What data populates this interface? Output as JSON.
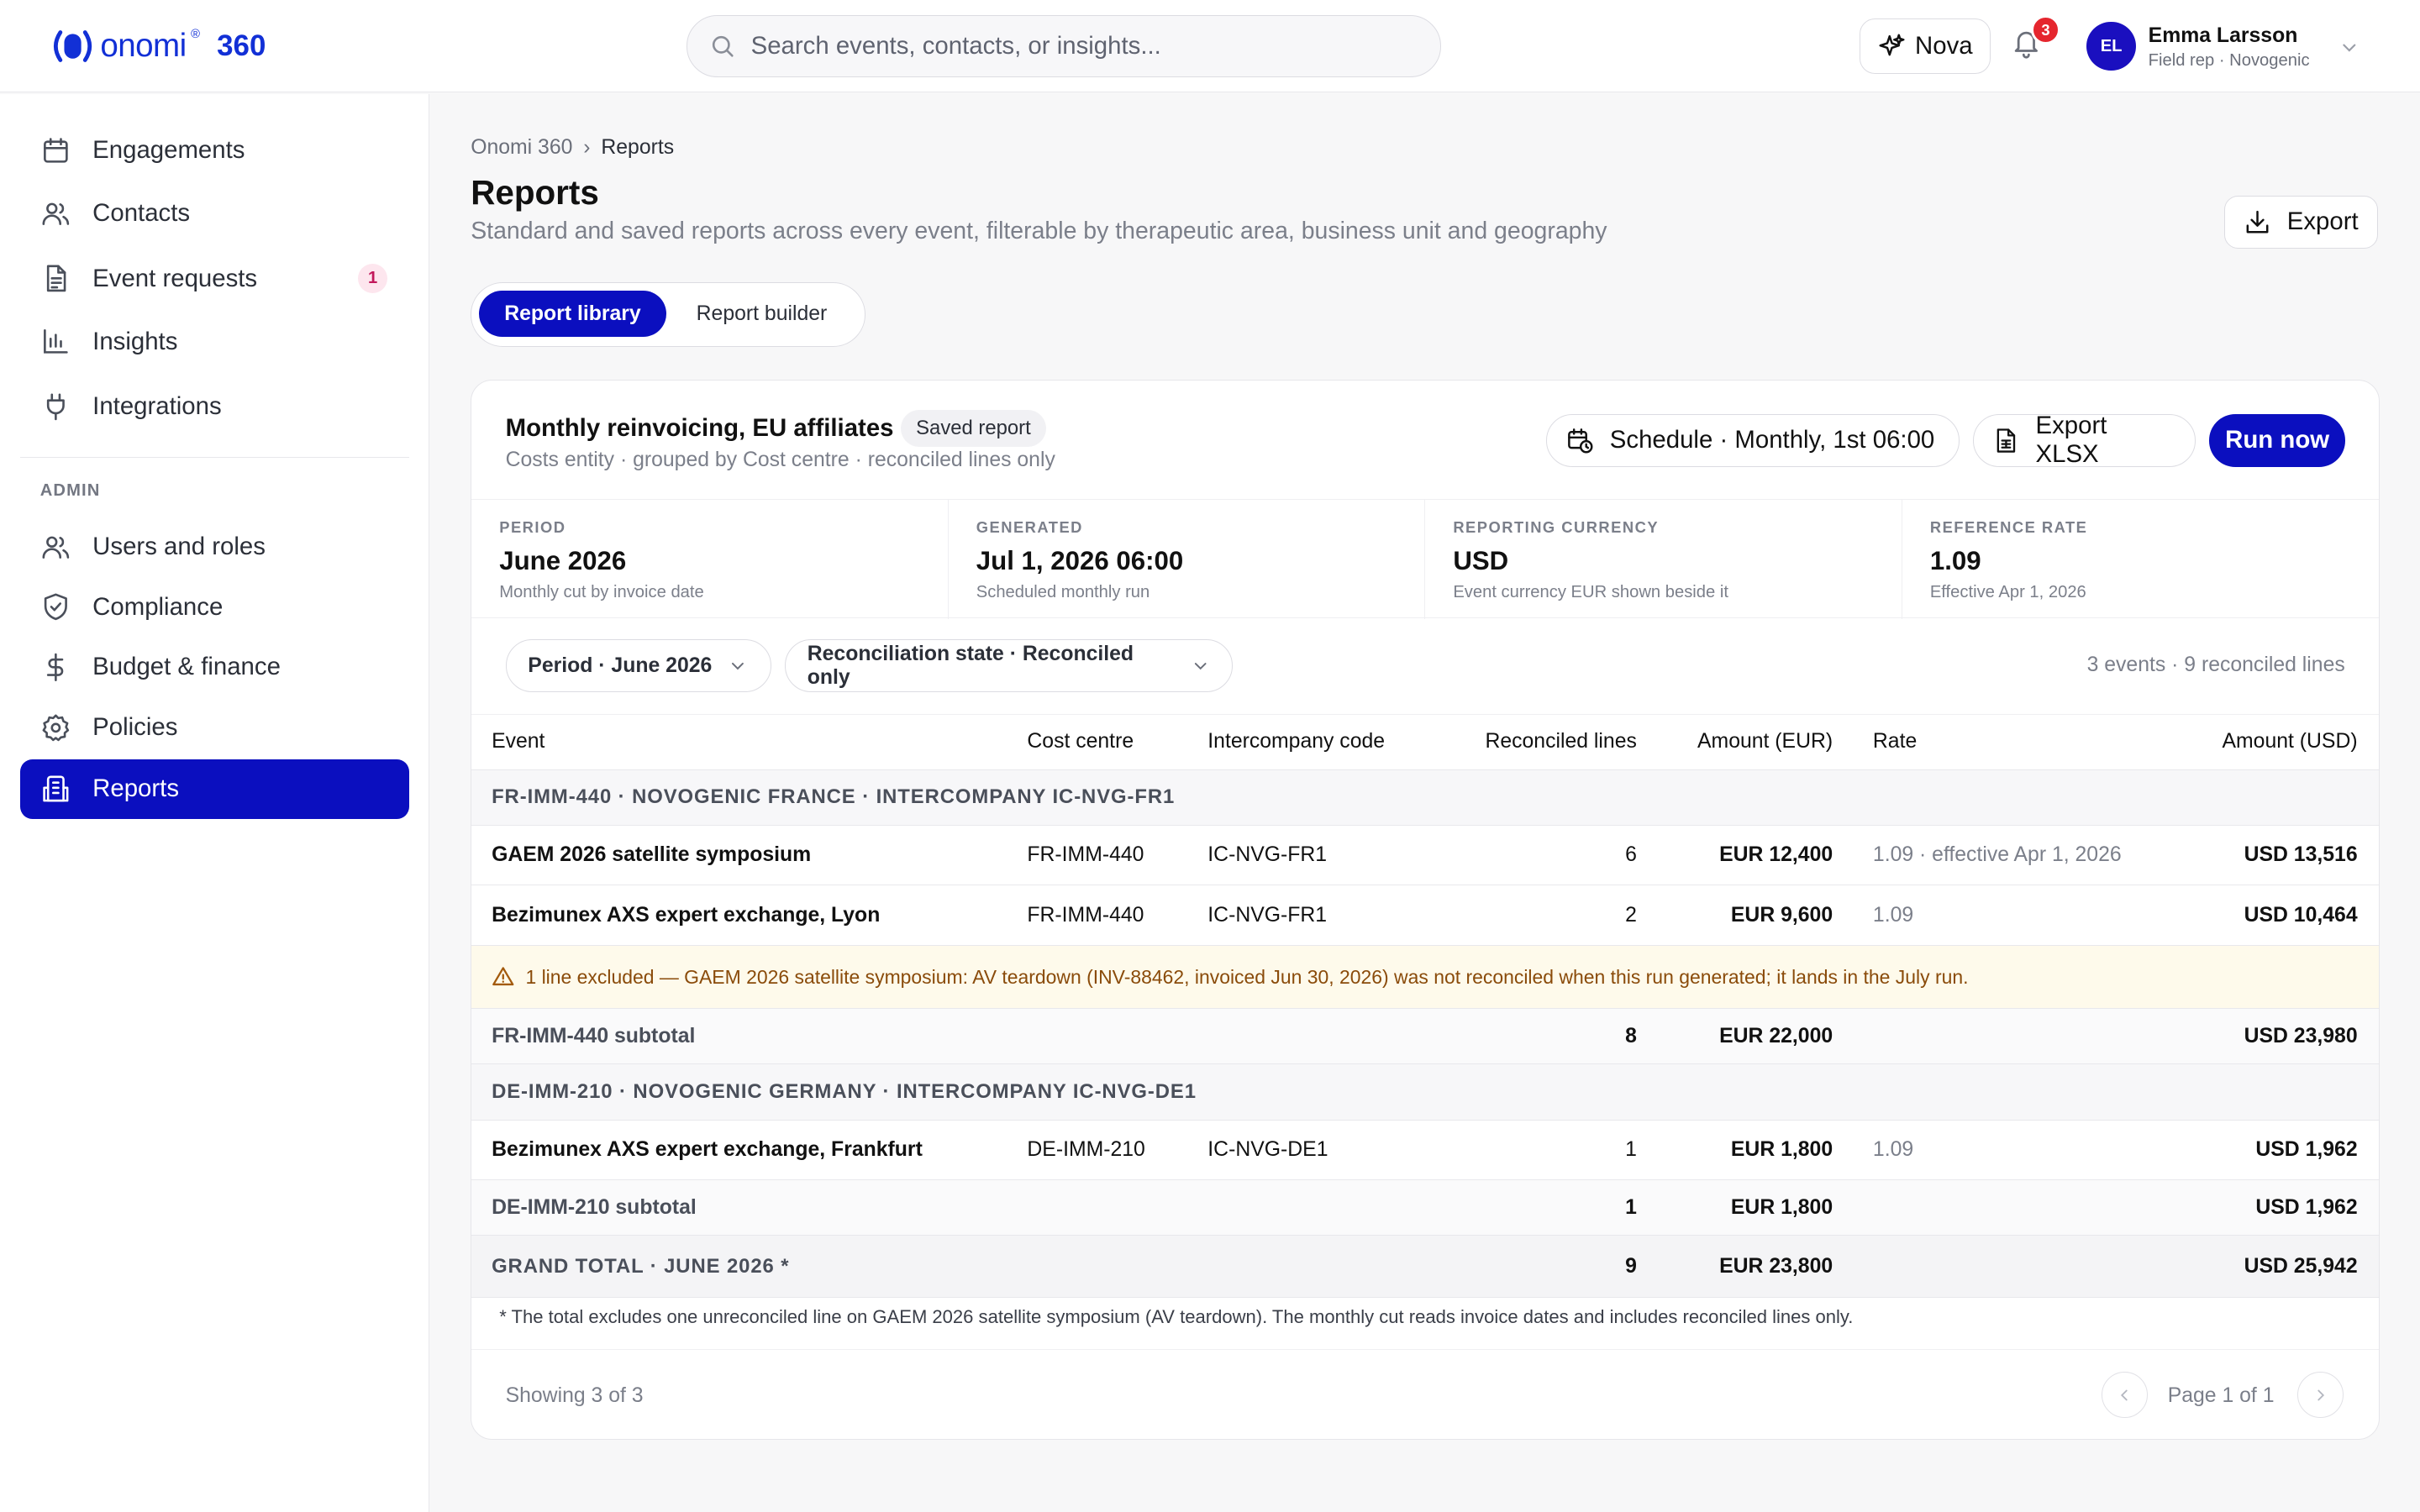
{
  "app": {
    "logo_word": "onomi",
    "logo_reg": "®",
    "logo_suffix": "360"
  },
  "search": {
    "placeholder": "Search events, contacts, or insights..."
  },
  "header": {
    "nova_label": "Nova",
    "notification_count": "3",
    "user": {
      "initials": "EL",
      "name": "Emma Larsson",
      "role": "Field rep · Novogenic"
    }
  },
  "sidebar": {
    "items": [
      {
        "label": "Engagements",
        "icon": "calendar-icon"
      },
      {
        "label": "Contacts",
        "icon": "users-icon"
      },
      {
        "label": "Event requests",
        "icon": "document-icon",
        "badge": "1"
      },
      {
        "label": "Insights",
        "icon": "bar-chart-icon"
      },
      {
        "label": "Integrations",
        "icon": "plug-icon"
      }
    ],
    "admin_heading": "ADMIN",
    "admin_items": [
      {
        "label": "Users and roles",
        "icon": "users-icon"
      },
      {
        "label": "Compliance",
        "icon": "shield-icon"
      },
      {
        "label": "Budget & finance",
        "icon": "dollar-icon"
      },
      {
        "label": "Policies",
        "icon": "gear-icon"
      },
      {
        "label": "Reports",
        "icon": "reports-icon",
        "active": true
      }
    ]
  },
  "breadcrumb": {
    "root": "Onomi 360",
    "separator": "›",
    "current": "Reports"
  },
  "page": {
    "title": "Reports",
    "subtitle": "Standard and saved reports across every event, filterable by therapeutic area, business unit and geography",
    "export_label": "Export"
  },
  "tabs": [
    {
      "label": "Report library",
      "active": true
    },
    {
      "label": "Report builder",
      "active": false
    }
  ],
  "report": {
    "title": "Monthly reinvoicing, EU affiliates",
    "pill": "Saved report",
    "subtitle": "Costs entity · grouped by Cost centre · reconciled lines only",
    "schedule_label": "Schedule · Monthly, 1st 06:00",
    "export_xlsx_label": "Export XLSX",
    "run_label": "Run now",
    "stats": [
      {
        "label": "PERIOD",
        "value": "June 2026",
        "note": "Monthly cut by invoice date"
      },
      {
        "label": "GENERATED",
        "value": "Jul 1, 2026 06:00",
        "note": "Scheduled monthly run"
      },
      {
        "label": "REPORTING CURRENCY",
        "value": "USD",
        "note": "Event currency EUR shown beside it"
      },
      {
        "label": "REFERENCE RATE",
        "value": "1.09",
        "note": "Effective Apr 1, 2026"
      }
    ],
    "filters": [
      {
        "label": "Period · June 2026"
      },
      {
        "label": "Reconciliation state · Reconciled only"
      }
    ],
    "counts": "3 events · 9 reconciled lines",
    "columns": [
      "Event",
      "Cost centre",
      "Intercompany code",
      "Reconciled lines",
      "Amount (EUR)",
      "Rate",
      "Amount (USD)"
    ],
    "group1": {
      "heading": "FR-IMM-440 · NOVOGENIC FRANCE · INTERCOMPANY IC-NVG-FR1",
      "rows": [
        {
          "event": "GAEM 2026 satellite symposium",
          "cost_centre": "FR-IMM-440",
          "ic_code": "IC-NVG-FR1",
          "lines": "6",
          "eur": "EUR 12,400",
          "rate": "1.09 · effective Apr 1, 2026",
          "usd": "USD 13,516"
        },
        {
          "event": "Bezimunex AXS expert exchange, Lyon",
          "cost_centre": "FR-IMM-440",
          "ic_code": "IC-NVG-FR1",
          "lines": "2",
          "eur": "EUR 9,600",
          "rate": "1.09",
          "usd": "USD 10,464"
        }
      ],
      "warning": "1 line excluded — GAEM 2026 satellite symposium: AV teardown (INV-88462, invoiced Jun 30, 2026) was not reconciled when this run generated; it lands in the July run.",
      "subtotal": {
        "label": "FR-IMM-440 subtotal",
        "lines": "8",
        "eur": "EUR 22,000",
        "usd": "USD 23,980"
      }
    },
    "group2": {
      "heading": "DE-IMM-210 · NOVOGENIC GERMANY · INTERCOMPANY IC-NVG-DE1",
      "rows": [
        {
          "event": "Bezimunex AXS expert exchange, Frankfurt",
          "cost_centre": "DE-IMM-210",
          "ic_code": "IC-NVG-DE1",
          "lines": "1",
          "eur": "EUR 1,800",
          "rate": "1.09",
          "usd": "USD 1,962"
        }
      ],
      "subtotal": {
        "label": "DE-IMM-210 subtotal",
        "lines": "1",
        "eur": "EUR 1,800",
        "usd": "USD 1,962"
      }
    },
    "grand_total": {
      "label": "GRAND TOTAL · JUNE 2026 *",
      "lines": "9",
      "eur": "EUR 23,800",
      "usd": "USD 25,942"
    },
    "footnote": "* The total excludes one unreconciled line on GAEM 2026 satellite symposium (AV teardown). The monthly cut reads invoice dates and includes reconciled lines only.",
    "showing": "Showing 3 of 3",
    "page_label": "Page 1 of 1"
  },
  "colors": {
    "accent": "#0b0fbf",
    "logo": "#1230d6",
    "badge_red": "#e5262e",
    "warning_bg": "#fefaeb"
  }
}
